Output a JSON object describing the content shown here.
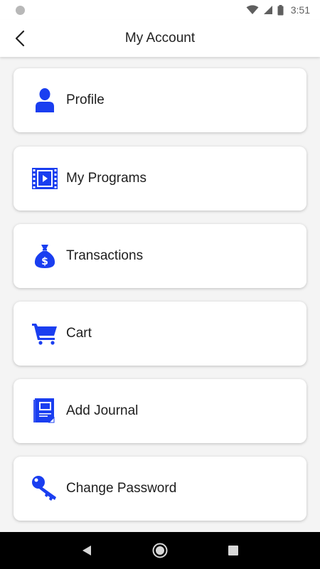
{
  "status_bar": {
    "time": "3:51",
    "icons": [
      "notification-dot-icon",
      "wifi-icon",
      "signal-icon",
      "battery-icon"
    ]
  },
  "header": {
    "title": "My Account",
    "back_icon": "chevron-left-icon"
  },
  "accent_color": "#1a3ef0",
  "menu": {
    "items": [
      {
        "label": "Profile",
        "icon": "person-icon"
      },
      {
        "label": "My Programs",
        "icon": "video-film-icon"
      },
      {
        "label": "Transactions",
        "icon": "money-bag-icon"
      },
      {
        "label": "Cart",
        "icon": "cart-icon"
      },
      {
        "label": "Add Journal",
        "icon": "journal-icon"
      },
      {
        "label": "Change Password",
        "icon": "key-icon"
      }
    ]
  },
  "nav_bar": {
    "buttons": [
      "back-triangle-icon",
      "home-circle-icon",
      "recents-square-icon"
    ]
  }
}
